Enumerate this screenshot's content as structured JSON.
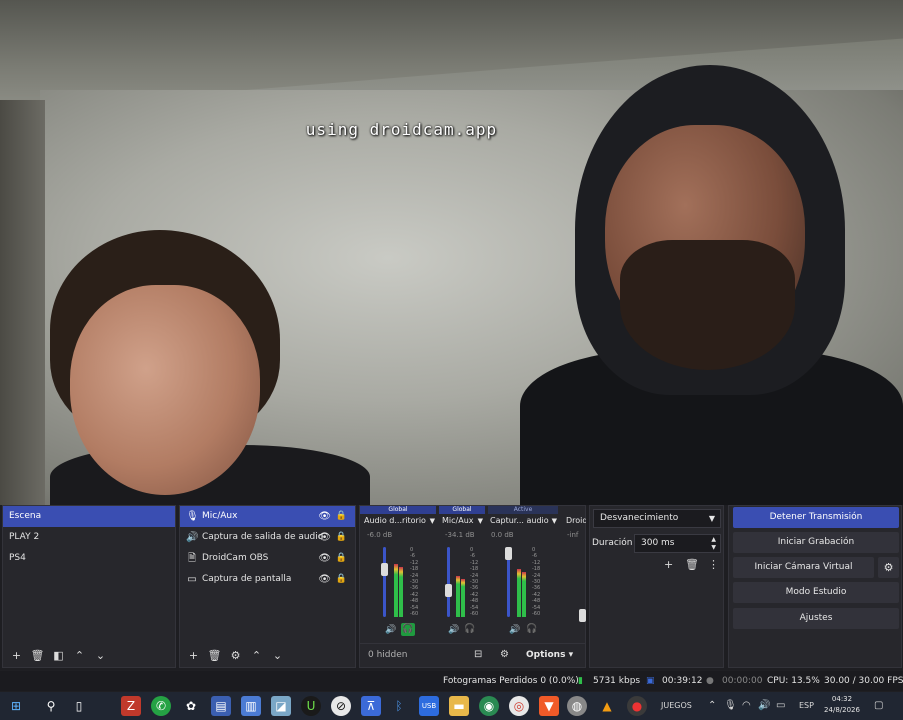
{
  "preview": {
    "watermark": "using droidcam.app"
  },
  "scenes": {
    "items": [
      {
        "label": "Escena",
        "active": true
      },
      {
        "label": "PLAY 2",
        "active": false
      },
      {
        "label": "PS4",
        "active": false
      }
    ],
    "toolbar_icons": [
      "plus-icon",
      "trash-icon",
      "filter-icon",
      "arrow-up-icon",
      "arrow-down-icon"
    ]
  },
  "sources": {
    "items": [
      {
        "label": "Mic/Aux",
        "icon": "microphone-icon",
        "active": true
      },
      {
        "label": "Captura de salida de audio",
        "icon": "speaker-icon",
        "active": false
      },
      {
        "label": "DroidCam OBS",
        "icon": "file-icon",
        "active": false
      },
      {
        "label": "Captura de pantalla",
        "icon": "monitor-icon",
        "active": false
      }
    ]
  },
  "mixer": {
    "headers": {
      "g1": "Global",
      "g2": "Global",
      "g3": "Active"
    },
    "channels": [
      {
        "name": "Audio d...ritorio",
        "db": "-6.0 dB",
        "level": 0.74,
        "meter": 0.8,
        "monitor_on": true
      },
      {
        "name": "Mic/Aux",
        "db": "-34.1 dB",
        "level": 0.4,
        "meter": 0.62,
        "monitor_on": false
      },
      {
        "name": "Captur... audio",
        "db": "0.0 dB",
        "level": 1.0,
        "meter": 0.72,
        "monitor_on": false
      },
      {
        "name": "Droid",
        "db": "-inf",
        "level": 0.0,
        "meter": 0.0,
        "monitor_on": false
      }
    ],
    "scale": [
      "0",
      "-6",
      "-12",
      "-18",
      "-24",
      "-30",
      "-36",
      "-42",
      "-48",
      "-54",
      "-60"
    ],
    "hidden_label": "0 hidden",
    "options_label": "Options"
  },
  "transitions": {
    "selected": "Desvanecimiento",
    "duration_label": "Duración",
    "duration_value": "300 ms"
  },
  "controls": {
    "stop_stream": "Detener Transmisión",
    "start_record": "Iniciar Grabación",
    "virtual_cam": "Iniciar Cámara Virtual",
    "studio_mode": "Modo Estudio",
    "settings": "Ajustes"
  },
  "status": {
    "dropped": "Fotogramas Perdidos 0 (0.0%)",
    "bitrate": "5731 kbps",
    "stream_time": "00:39:12",
    "record_time": "00:00:00",
    "cpu": "CPU: 13.5%",
    "fps": "30.00 / 30.00 FPS"
  },
  "taskbar": {
    "games_label": "JUEGOS",
    "lang": "ESP",
    "time": "04:32",
    "date": "24/8/2026"
  },
  "colors": {
    "accent": "#3a4eb2",
    "monitor_active": "#1f9a3f",
    "meter_green": "#2fbe4a",
    "meter_red": "#c8334a"
  }
}
